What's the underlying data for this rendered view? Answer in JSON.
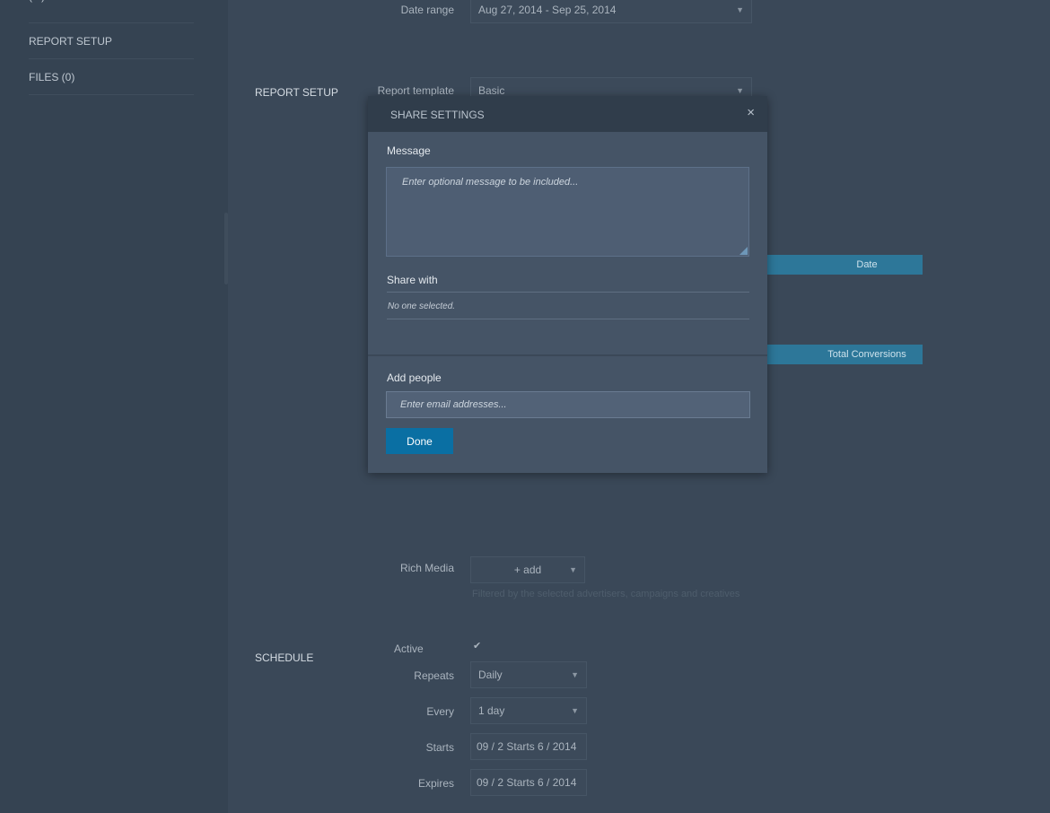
{
  "sidebar": {
    "top_item": "(...)",
    "items": [
      "REPORT SETUP",
      "FILES (0)"
    ]
  },
  "background": {
    "date_range_label": "Date range",
    "date_range_value": "Aug 27, 2014 - Sep 25, 2014",
    "report_setup_section": "REPORT SETUP",
    "report_template_label": "Report template",
    "report_template_value": "Basic",
    "col_header_date": "Date",
    "col_header_total_conversions": "Total Conversions",
    "rich_media_label": "Rich Media",
    "rich_media_add": "+ add",
    "rich_media_hint": "Filtered by the selected advertisers, campaigns and creatives",
    "schedule_section": "SCHEDULE",
    "active_label": "Active",
    "repeats_label": "Repeats",
    "repeats_value": "Daily",
    "every_label": "Every",
    "every_value": "1 day",
    "starts_label": "Starts",
    "starts_value": "09 / 2 Starts 6 / 2014",
    "expires_label": "Expires",
    "expires_value": "09 / 2 Starts 6 / 2014"
  },
  "modal": {
    "title": "SHARE SETTINGS",
    "close_glyph": "×",
    "message_label": "Message",
    "message_placeholder": "Enter optional message to be included...",
    "message_value": "",
    "share_with_label": "Share with",
    "share_with_value": "No one selected.",
    "add_people_label": "Add people",
    "email_placeholder": "Enter email addresses...",
    "email_value": "",
    "done_label": "Done"
  },
  "colors": {
    "page_bg": "#374555",
    "modal_bg": "#455466",
    "modal_header_bg": "#303d4b",
    "primary_button": "#0a6fa3",
    "table_header": "#2d7799"
  },
  "icons": {
    "close": "close-icon",
    "checkmark": "checkmark-icon",
    "caret": "chevron-down-icon"
  }
}
